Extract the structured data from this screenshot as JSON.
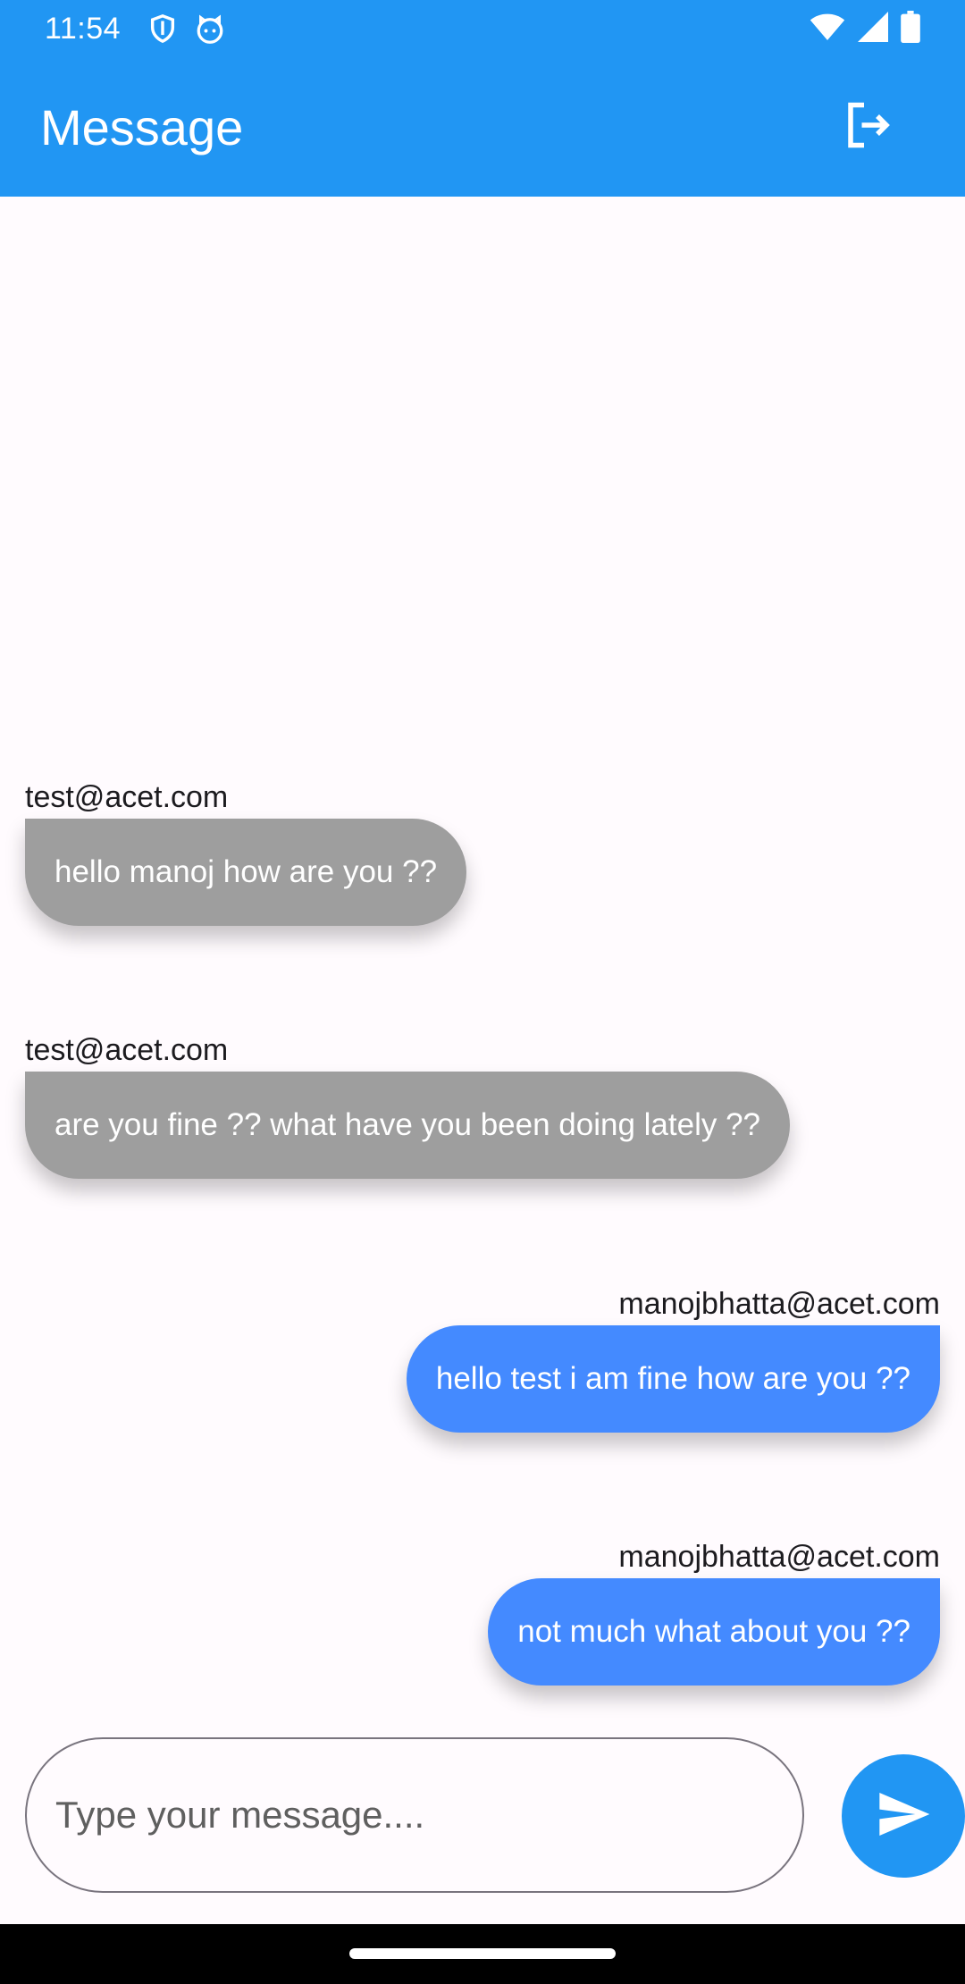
{
  "status_bar": {
    "time": "11:54",
    "icons": [
      "shield-icon",
      "cat-icon",
      "wifi-icon",
      "cellular-icon",
      "battery-icon"
    ]
  },
  "app_bar": {
    "title": "Message",
    "action_icon": "logout-icon",
    "color": "#2196f3"
  },
  "messages": [
    {
      "sender": "test@acet.com",
      "text": "hello manoj how are you ??",
      "direction": "received",
      "color": "#9e9e9e"
    },
    {
      "sender": "test@acet.com",
      "text": "are you fine ?? what have you been doing lately ??",
      "direction": "received",
      "color": "#9e9e9e"
    },
    {
      "sender": "manojbhatta@acet.com",
      "text": "hello test i am fine how are you ??",
      "direction": "sent",
      "color": "#448aff"
    },
    {
      "sender": "manojbhatta@acet.com",
      "text": "not much what about you ??",
      "direction": "sent",
      "color": "#448aff"
    }
  ],
  "composer": {
    "placeholder": "Type your message....",
    "value": "",
    "send_icon": "send-icon"
  }
}
